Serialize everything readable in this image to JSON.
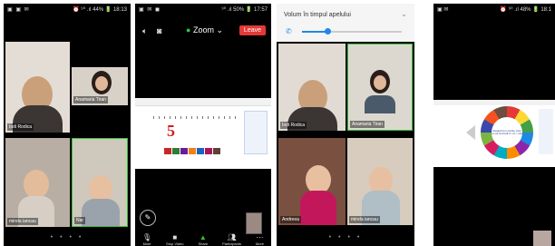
{
  "phones": [
    {
      "status_left": "▣ ▣ ✉",
      "status_right": "⏰ ⁹⁰ .ıl 44% 🔋 18:13",
      "tiles": [
        {
          "name": "Iodi Rodica"
        },
        {
          "name": "Anamaria Tiran"
        },
        {
          "name": "mirela iancau"
        },
        {
          "name": "Nar"
        }
      ]
    },
    {
      "status_left": "▣ ✉ ◼",
      "status_right": "⁹⁰ .ıl 50% 🔋 17:57",
      "app_name": "Zoom",
      "leave_label": "Leave",
      "slide_number": "5",
      "toolbar": [
        {
          "icon": "mic-icon",
          "label": "Mute"
        },
        {
          "icon": "video-icon",
          "label": "Stop Video"
        },
        {
          "icon": "share-icon",
          "label": "Share"
        },
        {
          "icon": "participants-icon",
          "label": "Participants"
        },
        {
          "icon": "more-icon",
          "label": "More"
        }
      ]
    },
    {
      "volume_label": "Volum în timpul apelului",
      "volume_level": 0.25,
      "tiles": [
        {
          "name": "Iodi Rodica"
        },
        {
          "name": "Anamaria Tiran"
        },
        {
          "name": "Andreea"
        },
        {
          "name": "mirela iancau"
        }
      ]
    },
    {
      "status_right": "⏰ ⁹⁰ .ıl 48% 🔋 18:1",
      "wheel_text": "Alegeți trei cuvinte care nu se termină în -ul / -ului"
    }
  ],
  "pager": "• • • •",
  "colors": {
    "active_border": "#36c336",
    "leave": "#e53935",
    "accent": "#1e88e5"
  }
}
